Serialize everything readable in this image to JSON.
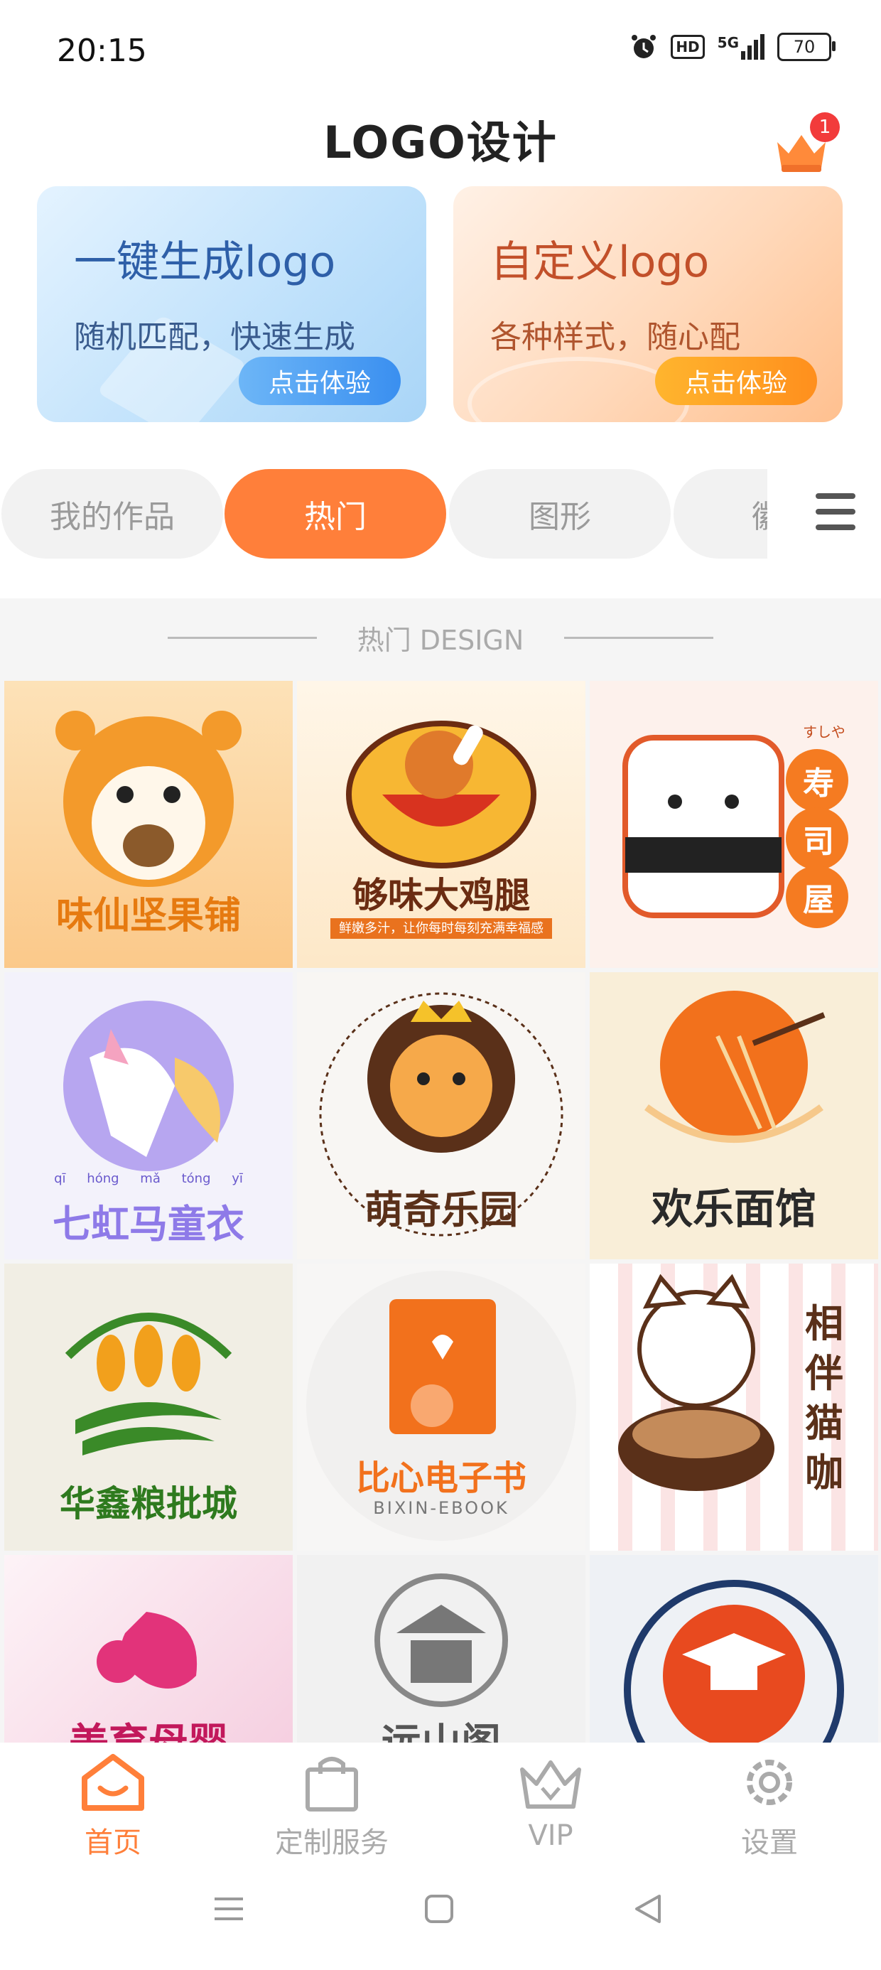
{
  "status_bar": {
    "time": "20:15",
    "hd_label": "HD",
    "network_label": "5G",
    "battery_level": "70"
  },
  "header": {
    "title": "LOGO设计",
    "vip_badge_count": "1"
  },
  "promo_cards": [
    {
      "title": "一键生成logo",
      "subtitle": "随机匹配，快速生成",
      "button": "点击体验"
    },
    {
      "title": "自定义logo",
      "subtitle": "各种样式，随心配",
      "button": "点击体验"
    }
  ],
  "tabs": [
    {
      "label": "我的作品",
      "active": false
    },
    {
      "label": "热门",
      "active": true
    },
    {
      "label": "图形",
      "active": false
    },
    {
      "label": "徽",
      "active": false
    }
  ],
  "section": {
    "heading": "热门 DESIGN"
  },
  "logos": [
    {
      "name": "味仙坚果铺"
    },
    {
      "name": "够味大鸡腿",
      "tagline": "鲜嫩多汁，让你每时每刻充满幸福感"
    },
    {
      "name": "寿司屋",
      "kana": "すしや"
    },
    {
      "name": "七虹马童衣",
      "pinyin": [
        "qī",
        "hóng",
        "mǎ",
        "tóng",
        "yī"
      ]
    },
    {
      "name": "萌奇乐园"
    },
    {
      "name": "欢乐面馆"
    },
    {
      "name": "华鑫粮批城"
    },
    {
      "name": "比心电子书",
      "latin": "BIXIN-EBOOK"
    },
    {
      "name": "相伴猫咖"
    },
    {
      "name": "美育母婴"
    },
    {
      "name": "远山阁"
    },
    {
      "name": ""
    }
  ],
  "bottom_nav": [
    {
      "label": "首页",
      "icon": "home-icon",
      "active": true
    },
    {
      "label": "定制服务",
      "icon": "bag-icon",
      "active": false
    },
    {
      "label": "VIP",
      "icon": "vip-crown-icon",
      "active": false
    },
    {
      "label": "设置",
      "icon": "gear-icon",
      "active": false
    }
  ],
  "colors": {
    "accent": "#ff7f3a",
    "tab_inactive_bg": "#f2f2f2",
    "badge": "#f23b3b"
  }
}
